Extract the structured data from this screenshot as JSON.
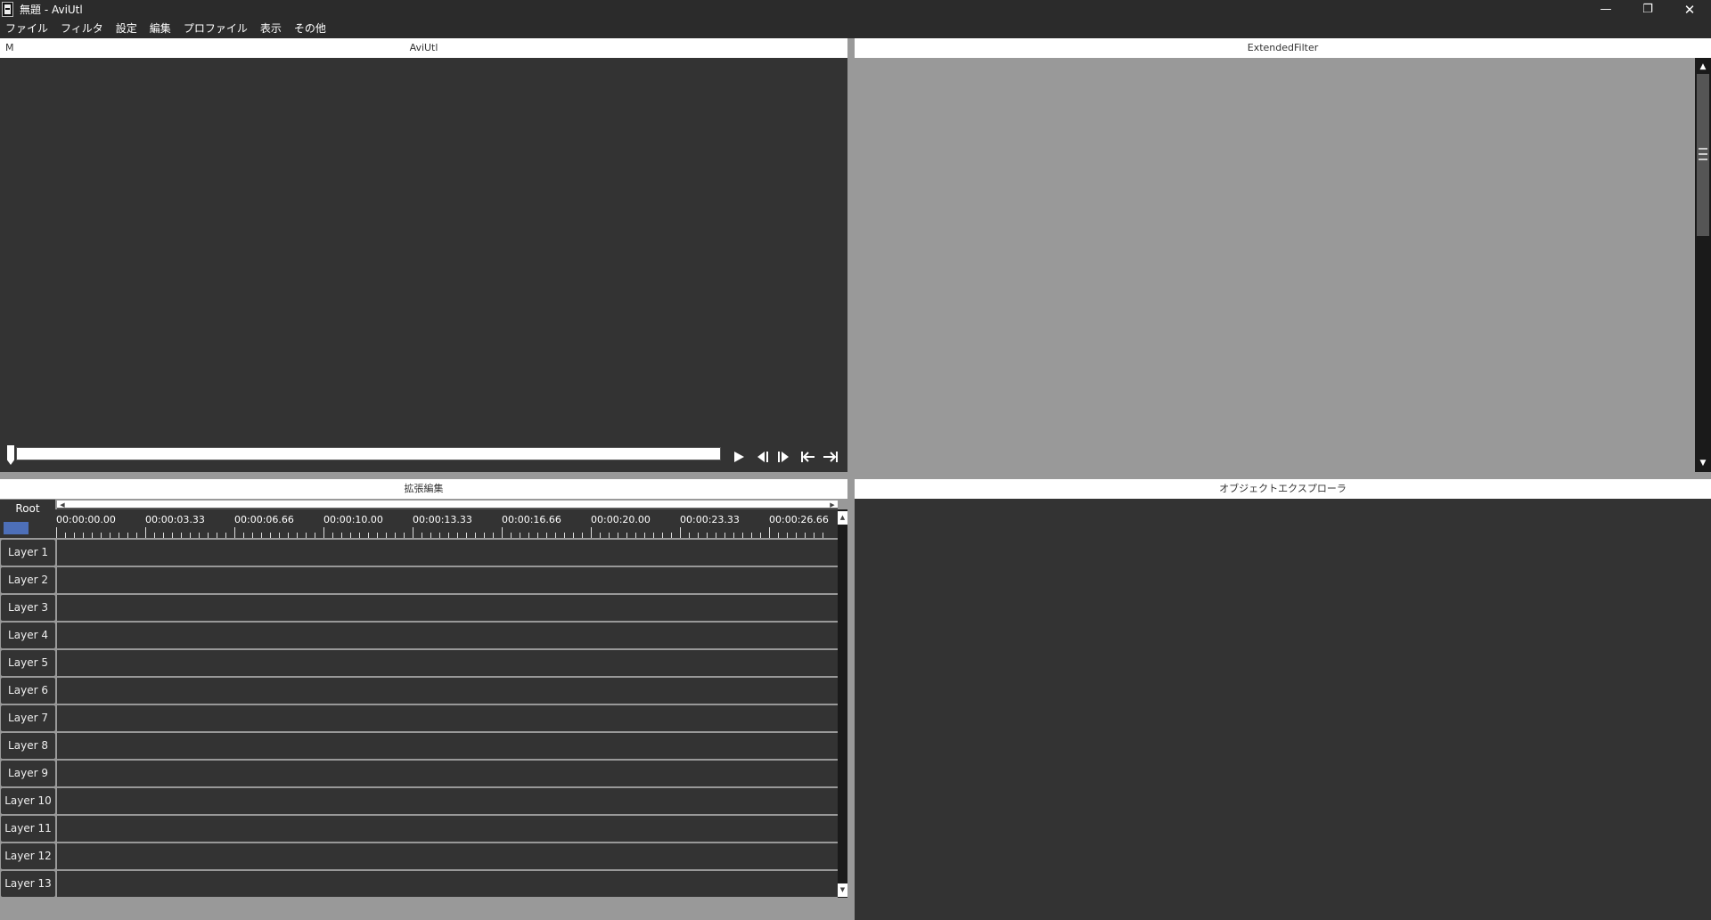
{
  "window": {
    "title": "無題 - AviUtl",
    "minimize": "—",
    "restore": "❐",
    "close": "✕"
  },
  "menu": [
    "ファイル",
    "フィルタ",
    "設定",
    "編集",
    "プロファイル",
    "表示",
    "その他"
  ],
  "video_panel": {
    "marker": "M",
    "title": "AviUtl",
    "seek_position": 0
  },
  "extended_filter_panel": {
    "title": "ExtendedFilter"
  },
  "timeline_panel": {
    "title": "拡張編集",
    "root_label": "Root",
    "time_ticks": [
      "00:00:00.00",
      "00:00:03.33",
      "00:00:06.66",
      "00:00:10.00",
      "00:00:13.33",
      "00:00:16.66",
      "00:00:20.00",
      "00:00:23.33",
      "00:00:26.66"
    ],
    "layers": [
      "Layer 1",
      "Layer 2",
      "Layer 3",
      "Layer 4",
      "Layer 5",
      "Layer 6",
      "Layer 7",
      "Layer 8",
      "Layer 9",
      "Layer 10",
      "Layer 11",
      "Layer 12",
      "Layer 13"
    ]
  },
  "object_explorer_panel": {
    "title": "オブジェクトエクスプローラ"
  },
  "icons": {
    "app": "aviutl-app-icon",
    "play": "play-icon",
    "prev_frame": "prev-frame-icon",
    "next_frame": "next-frame-icon",
    "jump_start": "jump-start-icon",
    "jump_end": "jump-end-icon"
  },
  "colors": {
    "dark_panel": "#333333",
    "gray_panel": "#999999",
    "header": "#ffffff",
    "selection_blue": "#4d6fb8"
  }
}
